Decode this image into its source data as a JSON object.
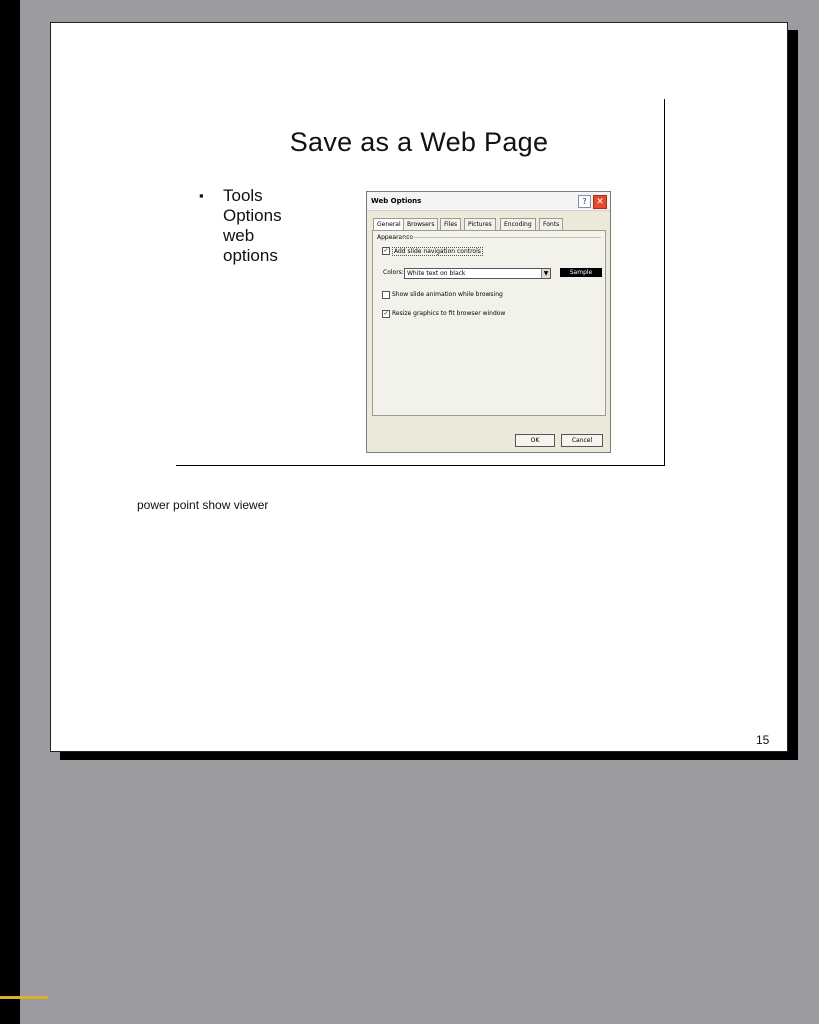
{
  "slide": {
    "title": "Save as a Web Page",
    "bullet_lines": [
      "Tools",
      "Options",
      "web",
      "options"
    ]
  },
  "dialog": {
    "title": "Web Options",
    "tabs": [
      "General",
      "Browsers",
      "Files",
      "Pictures",
      "Encoding",
      "Fonts"
    ],
    "group_label": "Appearance",
    "add_nav_label": "Add slide navigation controls",
    "add_nav_checked": true,
    "colors_label": "Colors:",
    "colors_value": "White text on black",
    "sample_label": "Sample",
    "show_anim_label": "Show slide animation while browsing",
    "show_anim_checked": false,
    "resize_label": "Resize graphics to fit browser window",
    "resize_checked": true,
    "ok_label": "OK",
    "cancel_label": "Cancel"
  },
  "notes_text": "power point show viewer",
  "page_number": "15"
}
